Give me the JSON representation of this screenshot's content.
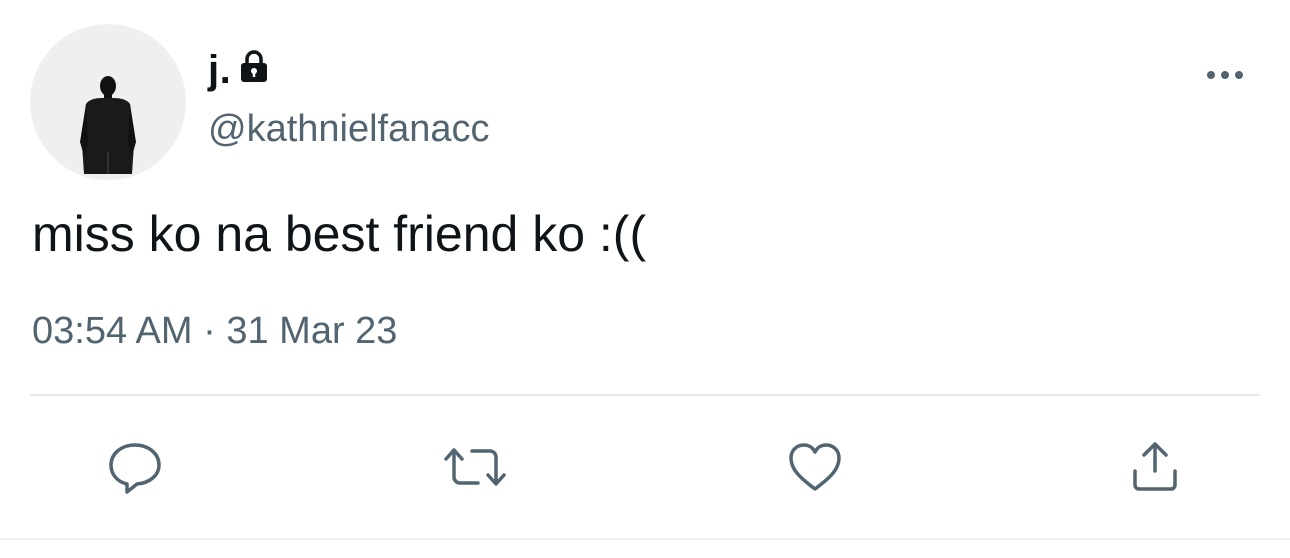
{
  "user": {
    "display_name": "j.",
    "handle": "@kathnielfanacc",
    "protected_icon": "lock-icon",
    "avatar": "avatar-man-in-suit-from-behind"
  },
  "tweet": {
    "text": "miss ko na best friend ko :((",
    "time": "03:54 AM",
    "separator": "·",
    "date": "31 Mar 23"
  },
  "menu": {
    "icon": "more-horizontal-icon"
  },
  "actions": [
    {
      "name": "reply",
      "icon": "speech-bubble-icon"
    },
    {
      "name": "retweet",
      "icon": "retweet-arrows-icon"
    },
    {
      "name": "like",
      "icon": "heart-icon"
    },
    {
      "name": "share",
      "icon": "share-upload-icon"
    }
  ],
  "colors": {
    "primary_text": "#0f1419",
    "secondary_text": "#536471",
    "divider": "#e6e9eb",
    "icon": "#536471",
    "avatar_bg": "#efefef"
  }
}
